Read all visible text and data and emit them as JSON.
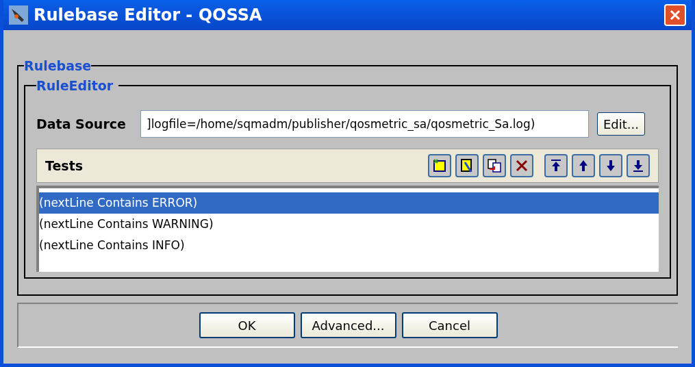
{
  "window": {
    "title": "Rulebase Editor - QOSSA"
  },
  "rulebase": {
    "legend": "Rulebase"
  },
  "rule_editor": {
    "legend": "RuleEditor"
  },
  "data_source": {
    "label": "Data Source",
    "value": "]logfile=/home/sqmadm/publisher/qosmetric_sa/qosmetric_Sa.log)",
    "button": "Edit..."
  },
  "tests": {
    "label": "Tests",
    "toolbar": [
      {
        "kind": "new"
      },
      {
        "kind": "edit"
      },
      {
        "kind": "copy"
      },
      {
        "kind": "delete"
      },
      {
        "kind": "top"
      },
      {
        "kind": "up"
      },
      {
        "kind": "down"
      },
      {
        "kind": "bottom"
      }
    ],
    "items": [
      {
        "text": "(nextLine Contains ERROR)",
        "selected": true
      },
      {
        "text": "(nextLine Contains WARNING)",
        "selected": false
      },
      {
        "text": "(nextLine Contains INFO)",
        "selected": false
      }
    ]
  },
  "buttons": [
    "OK",
    "Advanced...",
    "Cancel"
  ]
}
